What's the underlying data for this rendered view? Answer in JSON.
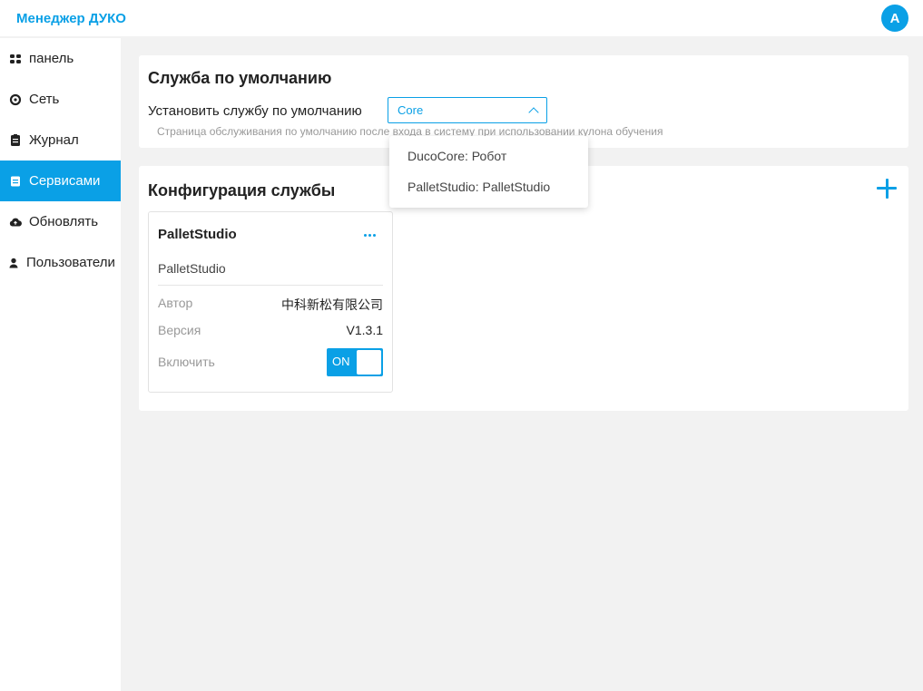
{
  "header": {
    "title": "Менеджер ДУКО",
    "avatar_letter": "A"
  },
  "sidebar": {
    "items": [
      {
        "label": "панель",
        "icon": "dashboard-icon",
        "active": false
      },
      {
        "label": "Сеть",
        "icon": "network-icon",
        "active": false
      },
      {
        "label": "Журнал",
        "icon": "journal-icon",
        "active": false
      },
      {
        "label": "Сервисами",
        "icon": "services-icon",
        "active": true
      },
      {
        "label": "Обновлять",
        "icon": "cloud-update-icon",
        "active": false
      },
      {
        "label": "Пользователи",
        "icon": "user-icon",
        "active": false
      }
    ]
  },
  "default_service": {
    "title": "Служба по умолчанию",
    "set_label": "Установить службу по умолчанию",
    "selected_value": "Core",
    "hint": "Страница обслуживания по умолчанию после входа в систему при использовании кулона обучения",
    "options": [
      "DucoCore: Робот",
      "PalletStudio: PalletStudio"
    ]
  },
  "service_config": {
    "title": "Конфигурация службы",
    "card": {
      "name": "PalletStudio",
      "description": "PalletStudio",
      "author_label": "Автор",
      "author_value": "中科新松有限公司",
      "version_label": "Версия",
      "version_value": "V1.3.1",
      "enable_label": "Включить",
      "toggle_text": "ON"
    }
  },
  "colors": {
    "accent": "#0aa0e6",
    "background": "#f2f2f2"
  }
}
